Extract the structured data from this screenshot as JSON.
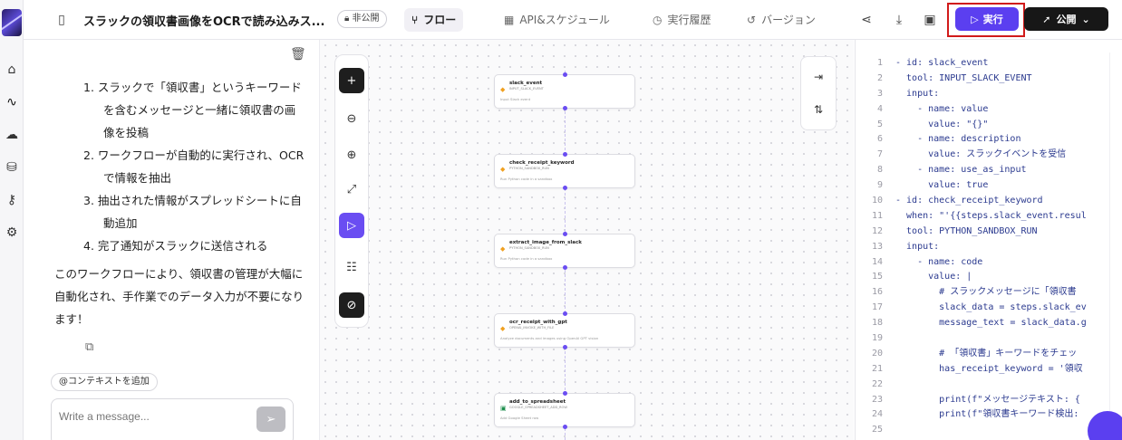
{
  "header": {
    "title": "スラックの領収書画像をOCRで読み込みス...",
    "private_badge": "非公開",
    "tabs": [
      {
        "label": "フロー",
        "icon": "flow-icon",
        "active": true
      },
      {
        "label": "API&スケジュール",
        "icon": "calendar-icon",
        "active": false
      },
      {
        "label": "実行履歴",
        "icon": "clock-icon",
        "active": false
      },
      {
        "label": "バージョン",
        "icon": "history-icon",
        "active": false
      }
    ],
    "run_label": "実行",
    "publish_label": "公開"
  },
  "chat": {
    "steps": [
      "1. スラックで「領収書」というキーワードを含むメッセージと一緒に領収書の画像を投稿",
      "2. ワークフローが自動的に実行され、OCRで情報を抽出",
      "3. 抽出された情報がスプレッドシートに自動追加",
      "4. 完了通知がスラックに送信される"
    ],
    "summary": "このワークフローにより、領収書の管理が大幅に自動化され、手作業でのデータ入力が不要になります！",
    "context_chip": "@コンテキストを追加",
    "message_placeholder": "Write a message..."
  },
  "flow": {
    "nodes": [
      {
        "name": "slack_event",
        "tool": "INPUT_SLACK_EVENT",
        "desc": "Input Slack event"
      },
      {
        "name": "check_receipt_keyword",
        "tool": "PYTHON_SANDBOX_RUN",
        "desc": "Run Python code in a sandbox"
      },
      {
        "name": "extract_image_from_slack",
        "tool": "PYTHON_SANDBOX_RUN",
        "desc": "Run Python code in a sandbox"
      },
      {
        "name": "ocr_receipt_with_gpt",
        "tool": "OPENAI_INVOKE_WITH_FILE",
        "desc": "Analyze documents and images using OpenAI GPT vision"
      },
      {
        "name": "add_to_spreadsheet",
        "tool": "GOOGLE_SPREADSHEET_ADD_ROW",
        "desc": "Add Google Sheet row"
      }
    ]
  },
  "code": {
    "lines": [
      "- id: slack_event",
      "  tool: INPUT_SLACK_EVENT",
      "  input:",
      "    - name: value",
      "      value: \"{}\"",
      "    - name: description",
      "      value: スラックイベントを受信",
      "    - name: use_as_input",
      "      value: true",
      "- id: check_receipt_keyword",
      "  when: \"'{{steps.slack_event.resul",
      "  tool: PYTHON_SANDBOX_RUN",
      "  input:",
      "    - name: code",
      "      value: |",
      "        # スラックメッセージに「領収書",
      "        slack_data = steps.slack_ev",
      "        message_text = slack_data.g",
      "",
      "        # 「領収書」キーワードをチェッ",
      "        has_receipt_keyword = '領収",
      "",
      "        print(f\"メッセージテキスト: {",
      "        print(f\"領収書キーワード検出:",
      ""
    ]
  }
}
